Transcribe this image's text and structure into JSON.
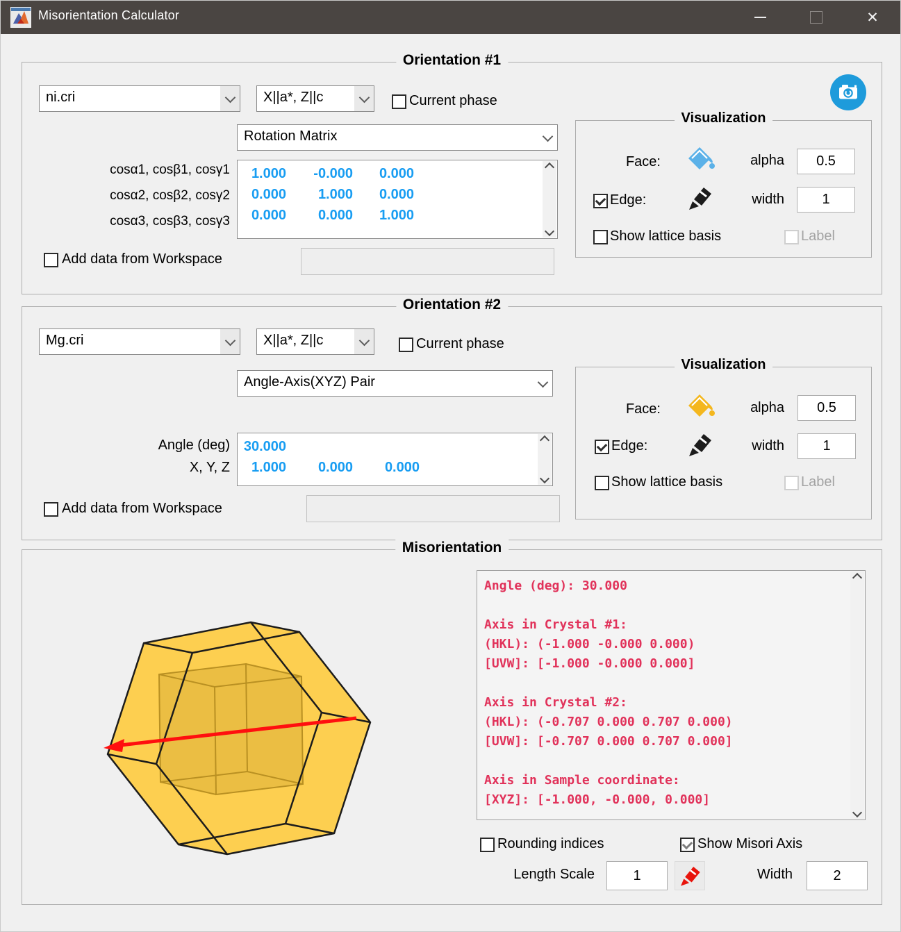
{
  "titlebar": {
    "title": "Misorientation Calculator"
  },
  "o1": {
    "title": "Orientation #1",
    "phase": "ni.cri",
    "axes_convention": "X||a*, Z||c",
    "current_phase_label": "Current phase",
    "representation": "Rotation Matrix",
    "row_labels": [
      "cosα1, cosβ1, cosγ1",
      "cosα2, cosβ2, cosγ2",
      "cosα3, cosβ3, cosγ3"
    ],
    "matrix": [
      [
        "1.000",
        "-0.000",
        "0.000"
      ],
      [
        "0.000",
        "1.000",
        "0.000"
      ],
      [
        "0.000",
        "0.000",
        "1.000"
      ]
    ],
    "workspace_label": "Add data from Workspace",
    "workspace_value": "",
    "viz": {
      "title": "Visualization",
      "face_label": "Face:",
      "alpha_label": "alpha",
      "alpha_value": "0.5",
      "edge_label": "Edge:",
      "width_label": "width",
      "width_value": "1",
      "lattice_label": "Show lattice basis",
      "label_label": "Label",
      "face_color": "#5bb1e8",
      "edge_checked": true,
      "lattice_checked": false,
      "label_checked": false
    },
    "current_phase_checked": false,
    "workspace_checked": false
  },
  "o2": {
    "title": "Orientation #2",
    "phase": "Mg.cri",
    "axes_convention": "X||a*, Z||c",
    "current_phase_label": "Current phase",
    "representation": "Angle-Axis(XYZ) Pair",
    "angle_label": "Angle (deg)",
    "xyz_label": "X, Y, Z",
    "angle_value": "30.000",
    "xyz": [
      "1.000",
      "0.000",
      "0.000"
    ],
    "workspace_label": "Add data from Workspace",
    "workspace_value": "",
    "viz": {
      "title": "Visualization",
      "face_label": "Face:",
      "alpha_label": "alpha",
      "alpha_value": "0.5",
      "edge_label": "Edge:",
      "width_label": "width",
      "width_value": "1",
      "lattice_label": "Show lattice basis",
      "label_label": "Label",
      "face_color": "#f4b71e",
      "edge_checked": true,
      "lattice_checked": false,
      "label_checked": false
    },
    "current_phase_checked": false,
    "workspace_checked": false
  },
  "miso": {
    "title": "Misorientation",
    "output_lines": [
      "Angle (deg): 30.000",
      "",
      "Axis in Crystal #1:",
      "(HKL): (-1.000 -0.000 0.000)",
      "[UVW]: [-1.000 -0.000 0.000]",
      "",
      "Axis in Crystal #2:",
      "(HKL): (-0.707 0.000 0.707 0.000)",
      "[UVW]: [-0.707 0.000 0.707 0.000]",
      "",
      "Axis in Sample coordinate:",
      "[XYZ]: [-1.000, -0.000, 0.000]"
    ],
    "rounding_label": "Rounding indices",
    "rounding_checked": false,
    "show_misori_label": "Show Misori Axis",
    "show_misori_checked": true,
    "length_scale_label": "Length Scale",
    "length_scale_value": "1",
    "width_label": "Width",
    "width_value": "2"
  },
  "colors": {
    "value_blue": "#189df2",
    "output_red": "#e1325a",
    "crystal_face_yellow": "#ffc72c",
    "misori_axis_red": "#ff0f0f",
    "camera_button_blue": "#1e9bdb",
    "titlebar_gray": "#4a4542"
  }
}
